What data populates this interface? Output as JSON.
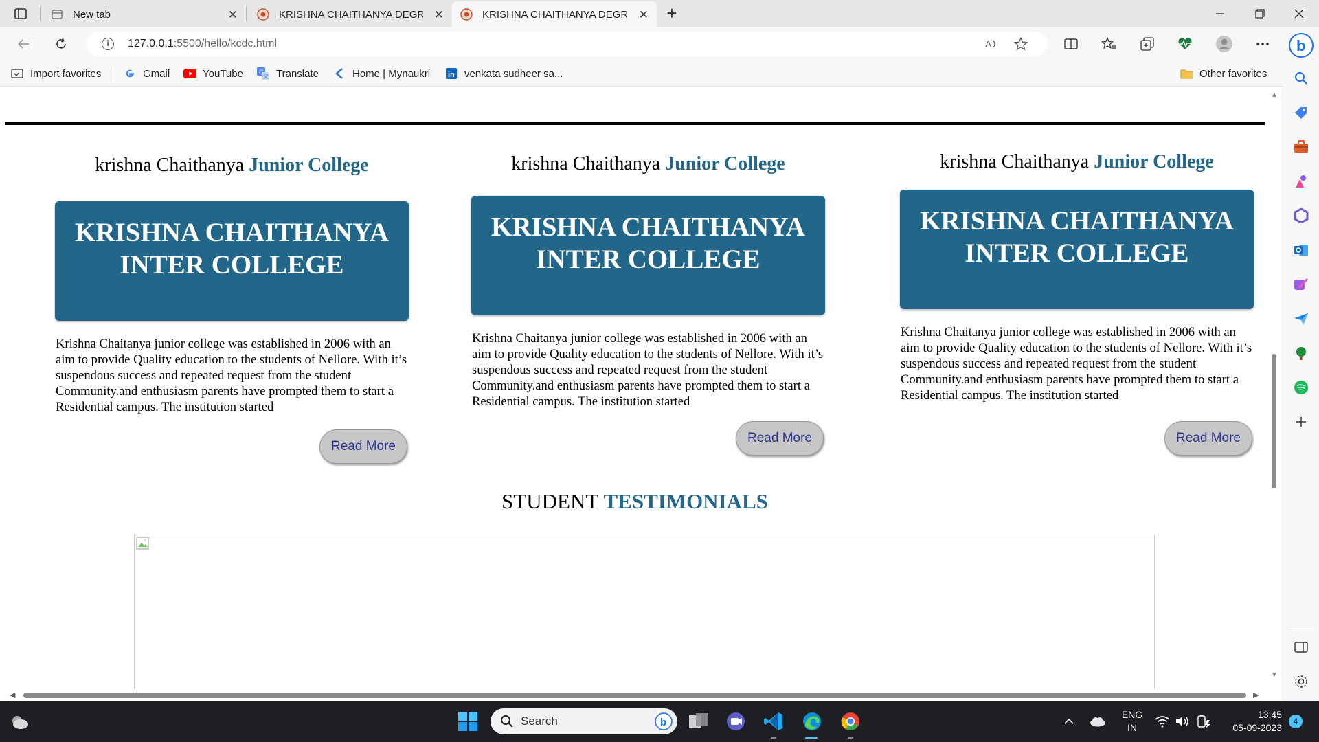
{
  "browser": {
    "tabs": [
      {
        "label": "New tab",
        "icon": "new-tab-page-icon",
        "close": "✕"
      },
      {
        "label": "KRISHNA CHAITHANYA DEGREE C",
        "icon": "site-favicon",
        "close": "✕"
      },
      {
        "label": "KRISHNA CHAITHANYA DEGREE C",
        "icon": "site-favicon",
        "close": "✕",
        "active": true
      }
    ],
    "new_tab_label": "+",
    "address": {
      "host": "127.0.0.1",
      "path": ":5500/hello/kcdc.html"
    },
    "favorites": [
      {
        "label": "Import favorites",
        "icon": "import-icon"
      },
      {
        "label": "Gmail",
        "icon": "google-icon"
      },
      {
        "label": "YouTube",
        "icon": "youtube-icon"
      },
      {
        "label": "Translate",
        "icon": "translate-icon"
      },
      {
        "label": "Home | Mynaukri",
        "icon": "naukri-icon"
      },
      {
        "label": "venkata sudheer sa...",
        "icon": "linkedin-icon"
      }
    ],
    "other_favorites": "Other favorites"
  },
  "page": {
    "columns": [
      {
        "heading_plain": "krishna Chaithanya ",
        "heading_accent": "Junior College",
        "box_title": "KRISHNA CHAITHANYA INTER COLLEGE",
        "description": "Krishna Chaitanya junior college was established in 2006 with an aim to provide Quality education to the students of Nellore. With it’s suspendous success and repeated request from the student Community.and enthusiasm parents have prompted them to start a Residential campus. The institution started",
        "button": "Read More"
      },
      {
        "heading_plain": "krishna Chaithanya ",
        "heading_accent": "Junior College",
        "box_title": "KRISHNA CHAITHANYA INTER COLLEGE",
        "description": "Krishna Chaitanya junior college was established in 2006 with an aim to provide Quality education to the students of Nellore. With it’s suspendous success and repeated request from the student Community.and enthusiasm parents have prompted them to start a Residential campus. The institution started",
        "button": "Read More"
      },
      {
        "heading_plain": "krishna Chaithanya ",
        "heading_accent": "Junior College",
        "box_title": "KRISHNA CHAITHANYA INTER COLLEGE",
        "description": "Krishna Chaitanya junior college was established in 2006 with an aim to provide Quality education to the students of Nellore. With it’s suspendous success and repeated request from the student Community.and enthusiasm parents have prompted them to start a Residential campus. The institution started",
        "button": "Read More"
      }
    ],
    "testimonials": {
      "plain": "STUDENT ",
      "accent": "TESTIMONIALS"
    }
  },
  "taskbar": {
    "search_placeholder": "Search",
    "lang_top": "ENG",
    "lang_bottom": "IN",
    "time": "13:45",
    "date": "05-09-2023",
    "notifications": "4"
  },
  "colors": {
    "accent": "#22678a",
    "button_text": "#2f3794"
  }
}
